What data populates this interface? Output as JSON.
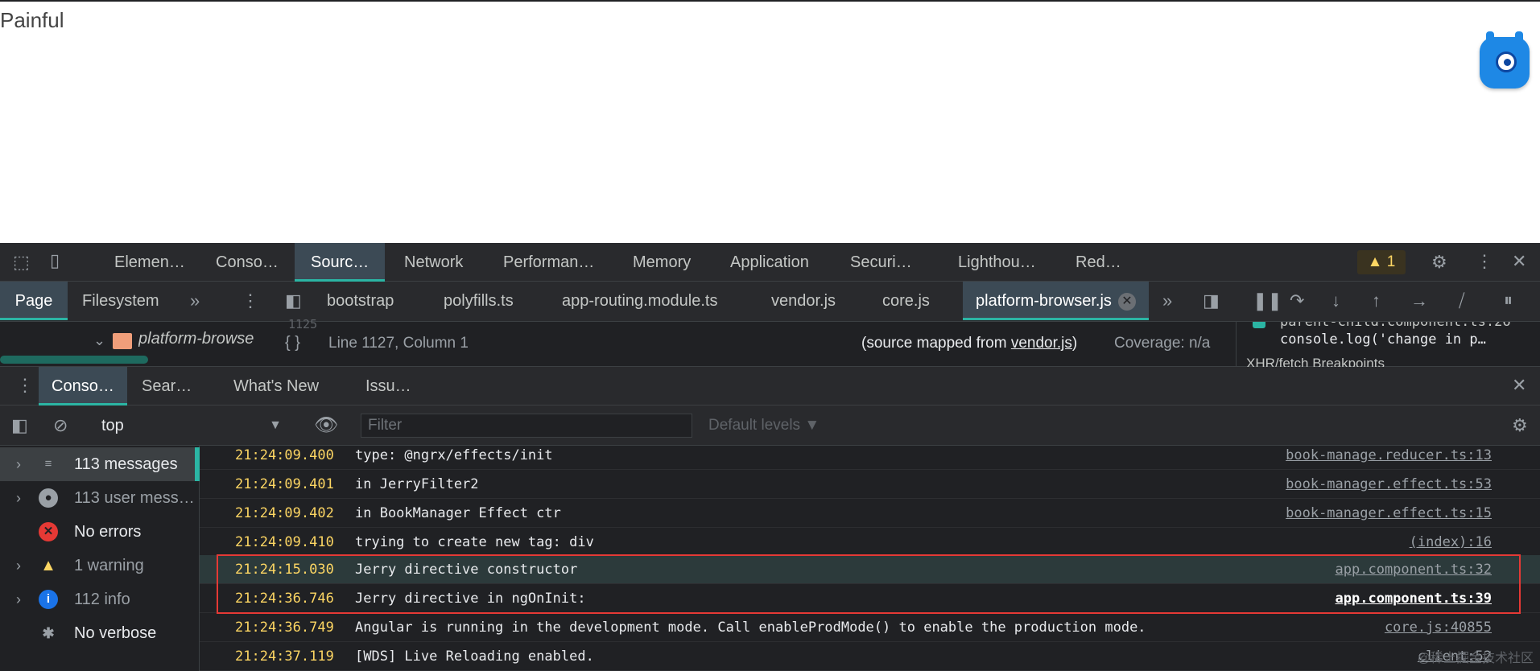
{
  "page": {
    "text": "Painful"
  },
  "devtools": {
    "main_tabs": [
      "Elemen…",
      "Conso…",
      "Sourc…",
      "Network",
      "Performan…",
      "Memory",
      "Application",
      "Securi…",
      "Lighthou…",
      "Red…"
    ],
    "active_main_tab": "Sourc…",
    "warning_count": "1",
    "nav_tabs": [
      "Page",
      "Filesystem"
    ],
    "file_tabs": [
      "bootstrap",
      "polyfills.ts",
      "app-routing.module.ts",
      "vendor.js",
      "core.js",
      "platform-browser.js"
    ],
    "active_file": "platform-browser.js",
    "tree_folder": "platform-browse",
    "line_hint": "1125",
    "status": {
      "cursor": "Line 1127, Column 1",
      "mapped_prefix": "(source mapped from ",
      "mapped_file": "vendor.js",
      "mapped_suffix": ")",
      "coverage": "Coverage: n/a"
    },
    "right_pane": {
      "breakpoint_file": "parent-child.component.ts:26",
      "breakpoint_code": "console.log('change in p…",
      "section": "XHR/fetch Breakpoints"
    },
    "drawer_tabs": [
      "Conso…",
      "Sear…",
      "What's New",
      "Issu…"
    ],
    "context": "top",
    "filter_placeholder": "Filter",
    "levels": "Default levels ▼",
    "sidebar": [
      {
        "label": "113 messages",
        "icon": "list-icon",
        "dim": false
      },
      {
        "label": "113 user mess…",
        "icon": "user-icon",
        "dim": true
      },
      {
        "label": "No errors",
        "icon": "error-icon",
        "dim": false
      },
      {
        "label": "1 warning",
        "icon": "warning-icon",
        "dim": true
      },
      {
        "label": "112 info",
        "icon": "info-icon",
        "dim": true
      },
      {
        "label": "No verbose",
        "icon": "bug-icon",
        "dim": false
      }
    ],
    "messages": [
      {
        "time": "21:24:09.400",
        "text": "type: @ngrx/effects/init",
        "source": "book-manage.reducer.ts:13"
      },
      {
        "time": "21:24:09.401",
        "text": "in JerryFilter2",
        "source": "book-manager.effect.ts:53"
      },
      {
        "time": "21:24:09.402",
        "text": "in BookManager Effect ctr",
        "source": "book-manager.effect.ts:15"
      },
      {
        "time": "21:24:09.410",
        "text": "trying to create new tag: div",
        "source": "(index):16"
      },
      {
        "time": "21:24:15.030",
        "text": "Jerry directive constructor",
        "source": "app.component.ts:32"
      },
      {
        "time": "21:24:36.746",
        "text": "Jerry directive in ngOnInit:",
        "source": "app.component.ts:39"
      },
      {
        "time": "21:24:36.749",
        "text": "Angular is running in the development mode. Call enableProdMode() to enable the production mode.",
        "source": "core.js:40855"
      },
      {
        "time": "21:24:37.119",
        "text": "[WDS] Live Reloading enabled.",
        "source": "client:52"
      }
    ],
    "watermark": "@稀土掘金技术社区"
  },
  "colors": {
    "accent": "#2bb5a4",
    "timestamp": "#fdd663",
    "highlight_box": "#e53935"
  }
}
